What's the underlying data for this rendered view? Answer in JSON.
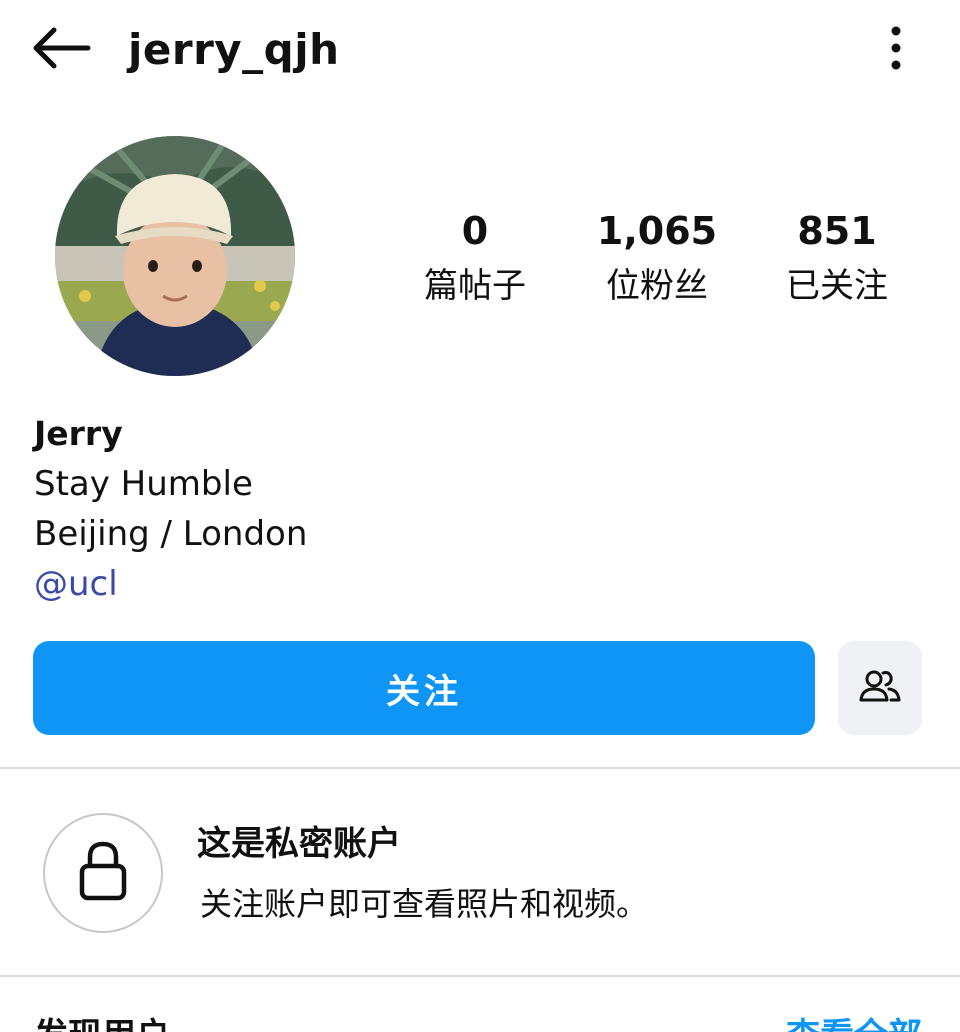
{
  "header": {
    "username": "jerry_qjh",
    "back_icon": "arrow-left-icon",
    "menu_icon": "more-vertical-icon"
  },
  "profile": {
    "avatar_icon": "profile-avatar-photo",
    "stats": {
      "posts": {
        "value": "0",
        "label": "篇帖子"
      },
      "followers": {
        "value": "1,065",
        "label": "位粉丝"
      },
      "following": {
        "value": "851",
        "label": "已关注"
      }
    },
    "name": "Jerry",
    "bio_lines": [
      "Stay Humble",
      "Beijing / London"
    ],
    "link": "@ucl"
  },
  "actions": {
    "follow_label": "关注",
    "suggested_icon": "people-icon"
  },
  "private_notice": {
    "icon": "lock-icon",
    "title": "这是私密账户",
    "description": "关注账户即可查看照片和视频。"
  },
  "discover": {
    "title": "发现用户",
    "see_all": "查看全部"
  },
  "colors": {
    "primary_button": "#0f95f6",
    "link": "#3b4aa8",
    "secondary_button": "#eff1f4",
    "divider": "#dbdbdb"
  }
}
